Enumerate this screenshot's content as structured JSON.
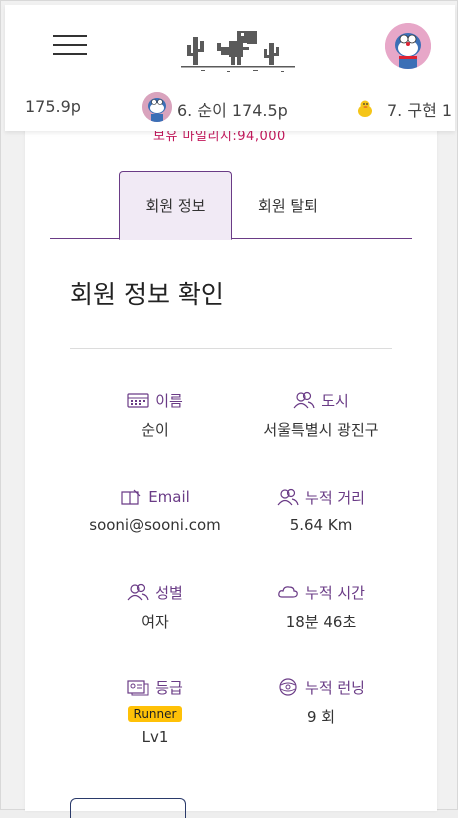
{
  "ticker": [
    {
      "text": "175.9p",
      "avatar": "none"
    },
    {
      "text": "6. 순이 174.5p",
      "avatar": "doraemon-avatar"
    },
    {
      "text": "7. 구현 1",
      "avatar": "duck-avatar"
    }
  ],
  "peek_text": "보유 마일리지:94,000",
  "tabs": {
    "info": "회원 정보",
    "withdraw": "회원 탈퇴"
  },
  "section_title": "회원 정보 확인",
  "fields": {
    "name": {
      "label": "이름",
      "value": "순이",
      "icon": "calendar-icon"
    },
    "city": {
      "label": "도시",
      "value": "서울특별시 광진구",
      "icon": "users-icon"
    },
    "email": {
      "label": "Email",
      "value": "sooni@sooni.com",
      "icon": "book-pencil-icon"
    },
    "distance": {
      "label": "누적 거리",
      "value": "5.64 Km",
      "icon": "users-icon"
    },
    "gender": {
      "label": "성별",
      "value": "여자",
      "icon": "users-icon"
    },
    "time": {
      "label": "누적 시간",
      "value": "18분 46초",
      "icon": "cloud-icon"
    },
    "grade": {
      "label": "등급",
      "badge": "Runner",
      "value": "Lv1",
      "icon": "id-card-icon"
    },
    "runs": {
      "label": "누적 런닝",
      "value": "9 회",
      "icon": "ball-icon"
    }
  },
  "colors": {
    "accent": "#6a3b86",
    "badge": "#ffc107",
    "peek": "#c2185b"
  }
}
